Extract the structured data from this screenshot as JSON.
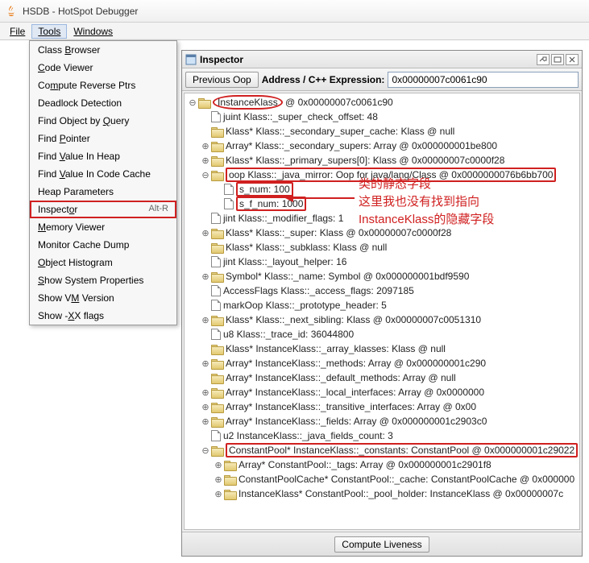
{
  "window": {
    "title": "HSDB - HotSpot Debugger"
  },
  "menubar": {
    "file": "File",
    "tools": "Tools",
    "windows": "Windows"
  },
  "tools_menu": {
    "items": [
      {
        "label": "Class Browser",
        "mn": 6
      },
      {
        "label": "Code Viewer",
        "mn": 0
      },
      {
        "label": "Compute Reverse Ptrs",
        "mn": 2
      },
      {
        "label": "Deadlock Detection",
        "mn": -1
      },
      {
        "label": "Find Object by Query",
        "mn": 15
      },
      {
        "label": "Find Pointer",
        "mn": 5
      },
      {
        "label": "Find Value In Heap",
        "mn": 5
      },
      {
        "label": "Find Value In Code Cache",
        "mn": 5
      },
      {
        "label": "Heap Parameters",
        "mn": -1
      },
      {
        "label": "Inspector",
        "mn": 7,
        "accel": "Alt-R",
        "hl": true
      },
      {
        "label": "Memory Viewer",
        "mn": 0
      },
      {
        "label": "Monitor Cache Dump",
        "mn": -1
      },
      {
        "label": "Object Histogram",
        "mn": 0
      },
      {
        "label": "Show System Properties",
        "mn": 0
      },
      {
        "label": "Show VM Version",
        "mn": 6
      },
      {
        "label": "Show -XX flags",
        "mn": 6
      }
    ]
  },
  "inspector": {
    "title": "Inspector",
    "prev_btn": "Previous Oop",
    "addr_label": "Address / C++ Expression:",
    "addr_value": "0x00000007c0061c90",
    "compute_btn": "Compute Liveness"
  },
  "tree": {
    "root_pre": "InstanceKlass",
    "root_post": " @ 0x00000007c0061c90",
    "n1": "juint Klass::_super_check_offset: 48",
    "n2": "Klass* Klass::_secondary_super_cache: Klass @ null",
    "n3": "Array<Klass*>* Klass::_secondary_supers: Array<Klass*> @ 0x000000001be800",
    "n4": "Klass* Klass::_primary_supers[0]: Klass @ 0x00000007c0000f28",
    "n5": "oop Klass::_java_mirror: Oop for java/lang/Class @ 0x0000000076b6bb700",
    "n5a": "s_num: 100",
    "n5b": "s_f_num: 1000",
    "n6": "jint Klass::_modifier_flags: 1",
    "n7": "Klass* Klass::_super: Klass @ 0x00000007c0000f28",
    "n8": "Klass* Klass::_subklass: Klass @ null",
    "n9": "jint Klass::_layout_helper: 16",
    "n10": "Symbol* Klass::_name: Symbol @ 0x000000001bdf9590",
    "n11": "AccessFlags Klass::_access_flags: 2097185",
    "n12": "markOop Klass::_prototype_header: 5",
    "n13": "Klass* Klass::_next_sibling: Klass @ 0x00000007c0051310",
    "n14": "u8 Klass::_trace_id: 36044800",
    "n15": "Klass* InstanceKlass::_array_klasses: Klass @ null",
    "n16": "Array<Method*>* InstanceKlass::_methods: Array<Method*> @ 0x000000001c290",
    "n17": "Array<Method*>* InstanceKlass::_default_methods: Array<Method*> @ null",
    "n18": "Array<Klass*>* InstanceKlass::_local_interfaces: Array<Klass*> @ 0x0000000",
    "n19": "Array<Klass*>* InstanceKlass::_transitive_interfaces: Array<Klass*> @ 0x00",
    "n20": "Array<u2>* InstanceKlass::_fields: Array<u2> @ 0x000000001c2903c0",
    "n21": "u2 InstanceKlass::_java_fields_count: 3",
    "n22": "ConstantPool* InstanceKlass::_constants: ConstantPool @ 0x000000001c29022",
    "n22a": "Array<u1>* ConstantPool::_tags: Array<u1> @ 0x000000001c2901f8",
    "n22b": "ConstantPoolCache* ConstantPool::_cache: ConstantPoolCache @ 0x000000",
    "n22c": "InstanceKlass* ConstantPool::_pool_holder: InstanceKlass @ 0x00000007c"
  },
  "annotations": {
    "l1": "类的静态字段",
    "l2": "这里我也没有找到指向",
    "l3": "InstanceKlass的隐藏字段"
  }
}
